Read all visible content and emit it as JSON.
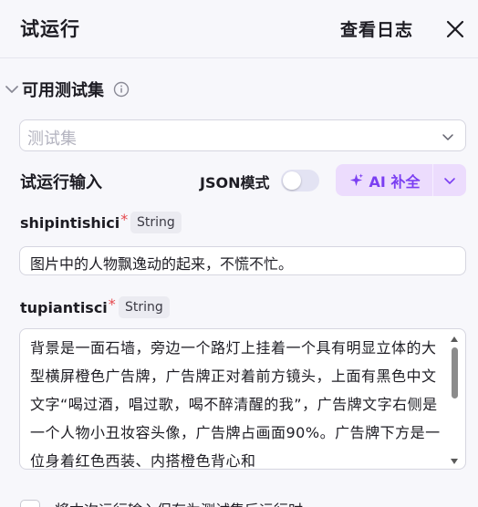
{
  "header": {
    "title": "试运行",
    "view_log_label": "查看日志",
    "close_icon": "close-icon"
  },
  "dataset_section": {
    "title": "可用测试集",
    "info_icon": "info-icon",
    "expanded": true,
    "select_placeholder": "测试集"
  },
  "run_input": {
    "label": "试运行输入",
    "json_mode_label": "JSON模式",
    "json_mode_on": false,
    "ai_complete_label": "AI 补全",
    "accent_color": "#7b3ff2"
  },
  "fields": [
    {
      "name": "shipintishici",
      "required_mark": "*",
      "type": "String",
      "value": "图片中的人物飘逸动的起来，不慌不忙。"
    },
    {
      "name": "tupiantisci",
      "required_mark": "*",
      "type": "String",
      "value": "背景是一面石墙，旁边一个路灯上挂着一个具有明显立体的大型横屏橙色广告牌，广告牌正对着前方镜头，上面有黑色中文文字“喝过酒，唱过歌，喝不醉清醒的我”，广告牌文字右侧是一个人物小丑妆容头像，广告牌占画面90%。广告牌下方是一位身着红色西装、内搭橙色背心和"
    }
  ],
  "save_option_label": "将本次运行输入保存为测试集后运行时"
}
